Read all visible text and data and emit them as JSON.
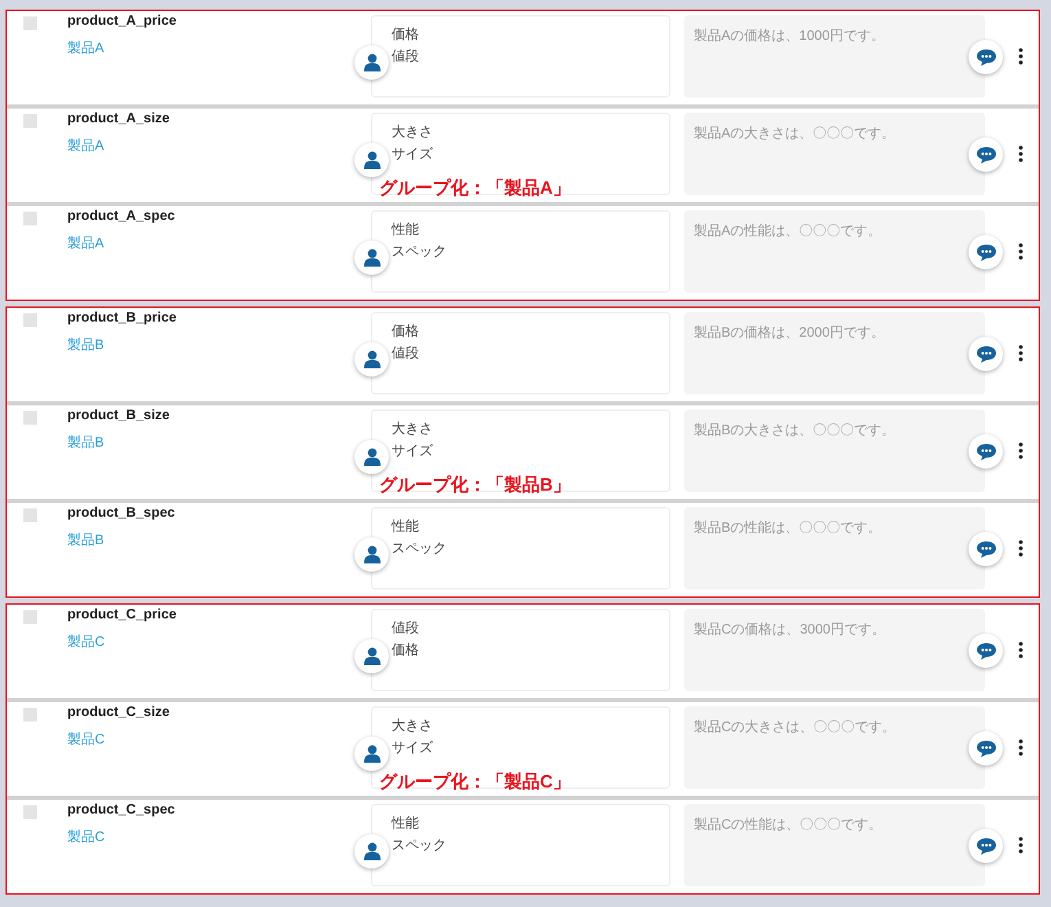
{
  "groups": [
    {
      "label": "グループ化：「製品A」",
      "rows": [
        {
          "checked": false,
          "name": "product_A_price",
          "tag": "製品A",
          "keywords": [
            "価格",
            "値段"
          ],
          "answer": "製品Aの価格は、1000円です。"
        },
        {
          "checked": false,
          "name": "product_A_size",
          "tag": "製品A",
          "keywords": [
            "大きさ",
            "サイズ"
          ],
          "answer": "製品Aの大きさは、〇〇〇です。"
        },
        {
          "checked": false,
          "name": "product_A_spec",
          "tag": "製品A",
          "keywords": [
            "性能",
            "スペック"
          ],
          "answer": "製品Aの性能は、〇〇〇です。"
        }
      ]
    },
    {
      "label": "グループ化：「製品B」",
      "rows": [
        {
          "checked": false,
          "name": "product_B_price",
          "tag": "製品B",
          "keywords": [
            "価格",
            "値段"
          ],
          "answer": "製品Bの価格は、2000円です。"
        },
        {
          "checked": false,
          "name": "product_B_size",
          "tag": "製品B",
          "keywords": [
            "大きさ",
            "サイズ"
          ],
          "answer": "製品Bの大きさは、〇〇〇です。"
        },
        {
          "checked": false,
          "name": "product_B_spec",
          "tag": "製品B",
          "keywords": [
            "性能",
            "スペック"
          ],
          "answer": "製品Bの性能は、〇〇〇です。"
        }
      ]
    },
    {
      "label": "グループ化：「製品C」",
      "rows": [
        {
          "checked": false,
          "name": "product_C_price",
          "tag": "製品C",
          "keywords": [
            "値段",
            "価格"
          ],
          "answer": "製品Cの価格は、3000円です。"
        },
        {
          "checked": false,
          "name": "product_C_size",
          "tag": "製品C",
          "keywords": [
            "大きさ",
            "サイズ"
          ],
          "answer": "製品Cの大きさは、〇〇〇です。"
        },
        {
          "checked": false,
          "name": "product_C_spec",
          "tag": "製品C",
          "keywords": [
            "性能",
            "スペック"
          ],
          "answer": "製品Cの性能は、〇〇〇です。"
        }
      ]
    }
  ]
}
